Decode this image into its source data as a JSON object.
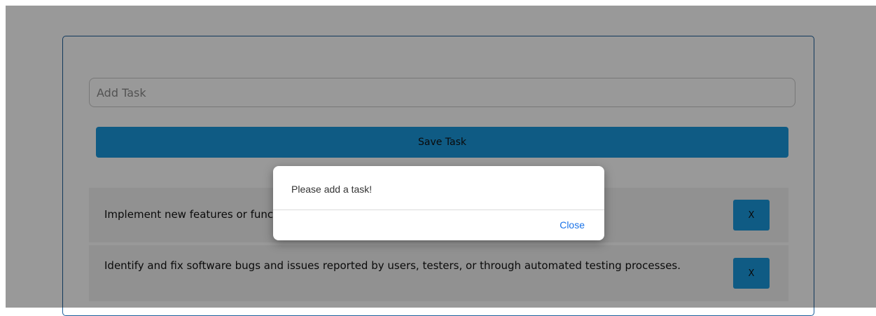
{
  "form": {
    "input_placeholder": "Add Task",
    "input_value": "",
    "save_label": "Save Task"
  },
  "tasks": [
    {
      "text": "Implement new features or functionality based on project requirements and user feedback.",
      "delete_label": "X"
    },
    {
      "text": "Identify and fix software bugs and issues reported by users, testers, or through automated testing processes.",
      "delete_label": "X"
    }
  ],
  "dialog": {
    "message": "Please add a task!",
    "close_label": "Close"
  },
  "colors": {
    "accent": "#1a98dd",
    "card_border": "#1d5f9a",
    "link": "#1a73e8",
    "task_row_bg": "#f2f2f2"
  }
}
